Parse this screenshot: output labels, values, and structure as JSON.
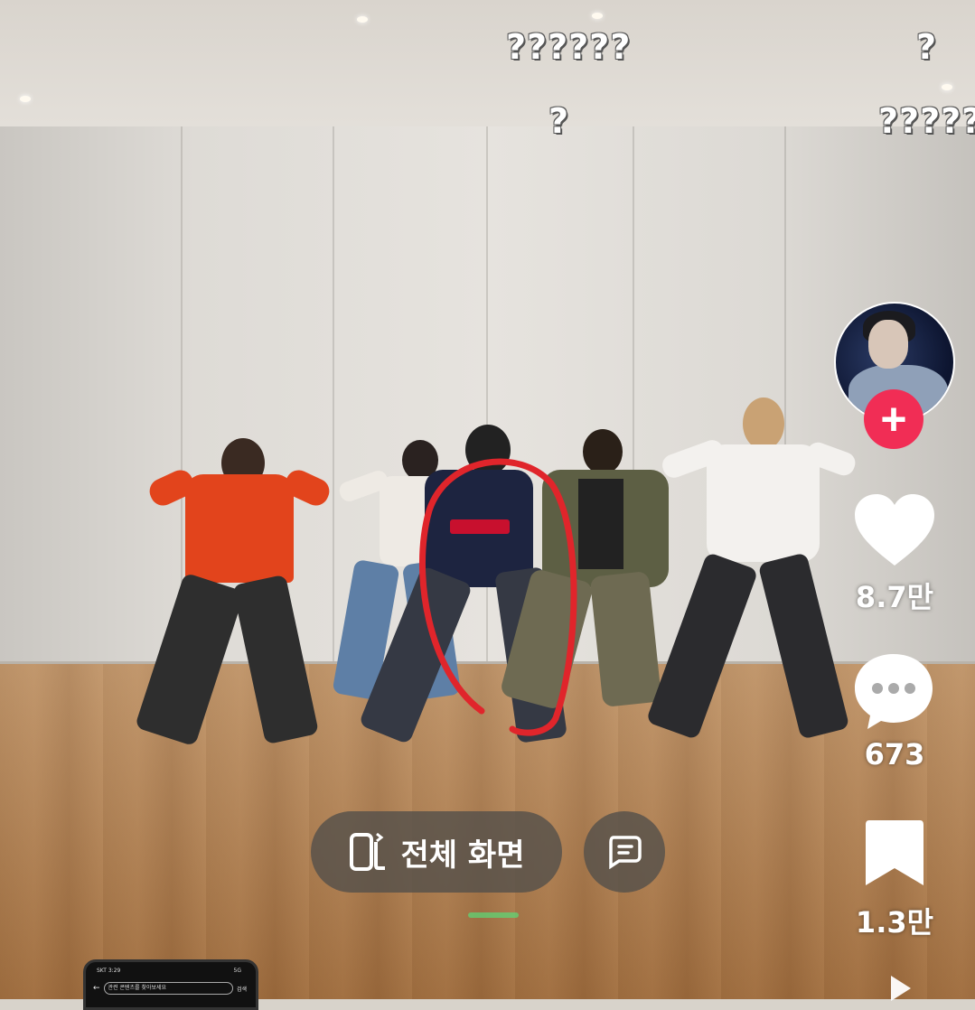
{
  "overlay_comments": [
    "??????",
    "?",
    "?",
    "?????"
  ],
  "rail": {
    "like_count": "8.7만",
    "comment_count": "673",
    "save_count": "1.3만",
    "follow_symbol": "+"
  },
  "controls": {
    "fullscreen_label": "전체 화면"
  },
  "mini_phone": {
    "status_left": "SKT 3:29",
    "status_right": "5G",
    "search_placeholder": "관련 콘텐츠를 찾아보세요",
    "search_button": "검색"
  },
  "colors": {
    "follow_accent": "#f12d55",
    "marker": "#e0252b"
  }
}
